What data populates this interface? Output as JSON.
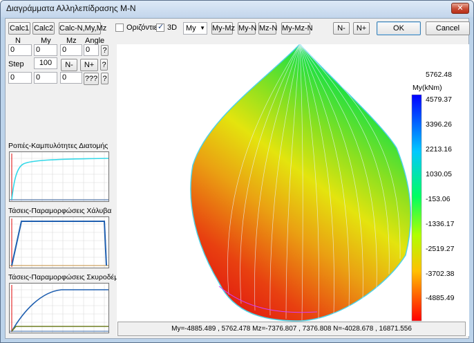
{
  "window": {
    "title": "Διαγράμματα Αλληλεπίδρασης Μ-Ν",
    "close_glyph": "✕"
  },
  "toolbar": {
    "calc1": "Calc1",
    "calc2": "Calc2",
    "calc_nmymz": "Calc-N,My,Mz",
    "horizontal_label": "Οριζόντιες",
    "horizontal_checked": false,
    "threed_label": "3D",
    "threed_checked": true,
    "axis_select": "My",
    "my_mz": "My-Mz",
    "my_n": "My-N",
    "mz_n": "Mz-N",
    "my_mz_n": "My-Mz-N",
    "n_minus": "N-",
    "n_plus": "N+",
    "ok": "OK",
    "cancel": "Cancel"
  },
  "inputs": {
    "headers": {
      "n": "N",
      "my": "My",
      "mz": "Mz",
      "angle": "Angle"
    },
    "n_value": "0",
    "my_value": "0",
    "mz_value": "0",
    "angle_value": "0",
    "step_label": "Step",
    "step_value": "100",
    "n_minus": "N-",
    "n_plus": "N+",
    "help": "?",
    "qqq": "???",
    "row3": [
      "0",
      "0",
      "0"
    ]
  },
  "graphs": {
    "moments_title": "Ροπές-Καμπυλότητες Διατομής",
    "steel_title": "Τάσεις-Παραμορφώσεις Χάλυβα",
    "concrete_title": "Τάσεις-Παραμορφώσεις Σκυροδέμ."
  },
  "colorbar": {
    "title": "My(kNm)",
    "ticks": [
      "5762.48",
      "4579.37",
      "3396.26",
      "2213.16",
      "1030.05",
      "-153.06",
      "-1336.17",
      "-2519.27",
      "-3702.38",
      "-4885.49"
    ]
  },
  "status": "My=-4885.489 , 5762.478 Mz=-7376.807 , 7376.808 N=-4028.678 , 16871.556"
}
